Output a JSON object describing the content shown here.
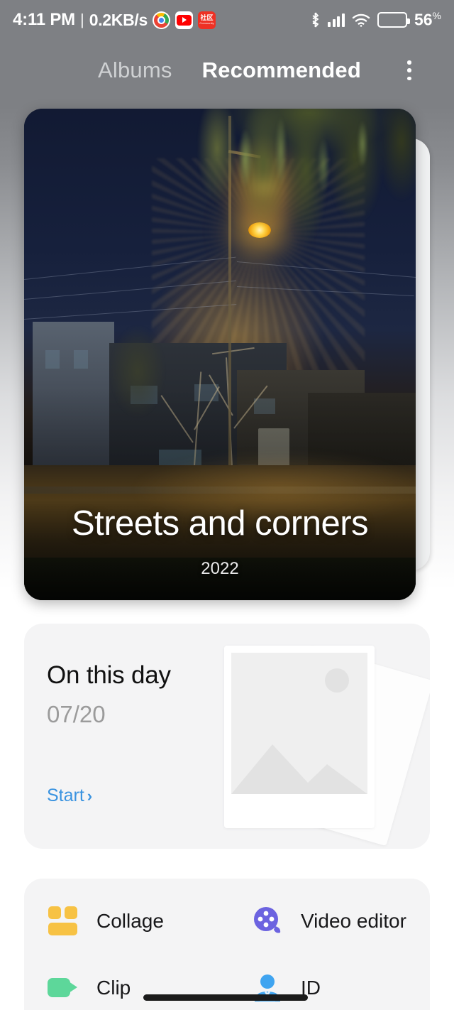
{
  "status_bar": {
    "time": "4:11 PM",
    "separator": "|",
    "network_speed": "0.2KB/s",
    "app_icons": [
      {
        "name": "chrome-icon",
        "label": "Chrome"
      },
      {
        "name": "youtube-icon",
        "label": "YouTube"
      },
      {
        "name": "community-app-icon",
        "label": "社区"
      }
    ],
    "community_icon_text": "社区",
    "community_icon_sub": "Community",
    "bluetooth": "bluetooth-icon",
    "signal": "cellular-signal-icon",
    "wifi": "wifi-icon",
    "battery_percent": "56",
    "battery_unit": "%",
    "battery_level": 56,
    "battery_color": "#F5A623"
  },
  "tabs": {
    "albums_label": "Albums",
    "recommended_label": "Recommended",
    "active": "Recommended",
    "overflow_label": "More options"
  },
  "hero": {
    "title": "Streets and corners",
    "year": "2022",
    "scene": "night street with glowing streetlamp"
  },
  "on_this_day": {
    "title": "On this day",
    "date": "07/20",
    "start_label": "Start",
    "start_chevron": "›",
    "accent_color": "#3A93E0"
  },
  "tools": [
    {
      "name": "collage",
      "label": "Collage",
      "color": "#F7C244"
    },
    {
      "name": "video-editor",
      "label": "Video editor",
      "color": "#6C63E0"
    },
    {
      "name": "clip",
      "label": "Clip",
      "color": "#5DD79A"
    },
    {
      "name": "id",
      "label": "ID",
      "color": "#3FA4F0"
    }
  ],
  "colors": {
    "page_background": "#FFFFFF",
    "card_background": "#F4F4F5",
    "header_overlay": "#7E8084",
    "tab_active": "#FFFFFF",
    "tab_inactive": "#CFD1D3"
  }
}
